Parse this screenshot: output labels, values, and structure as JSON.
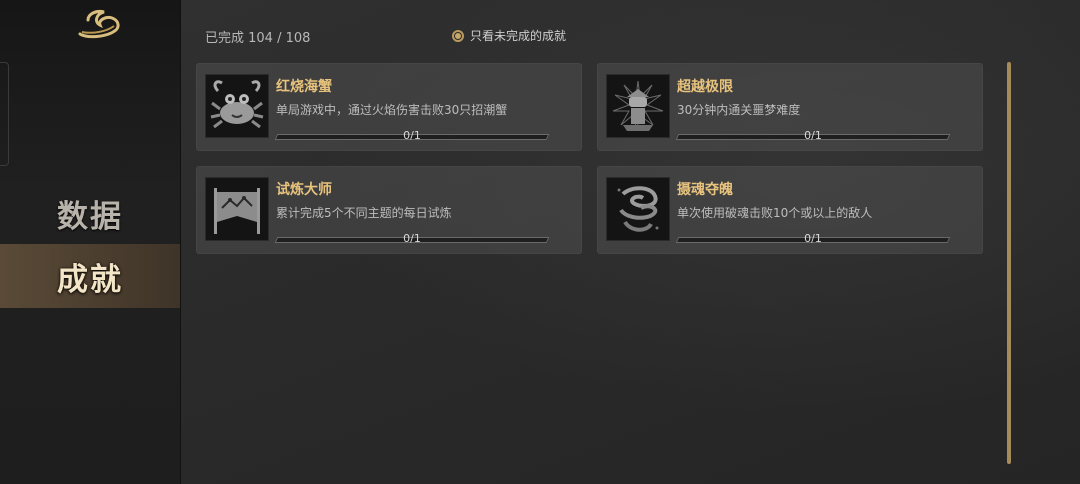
{
  "colors": {
    "accent_gold": "#e7c37d",
    "scrollbar": "#a58a5a",
    "selected_nav_bg": "#5a4a37"
  },
  "sidebar": {
    "logo_icon": "cloud-swirl-logo",
    "items": [
      {
        "label": "数据",
        "selected": false
      },
      {
        "label": "成就",
        "selected": true
      }
    ]
  },
  "header": {
    "completed_text": "已完成 104 / 108",
    "filter_label": "只看未完成的成就",
    "filter_checked": true
  },
  "achievements": [
    {
      "title": "红烧海蟹",
      "description": "单局游戏中，通过火焰伤害击败30只招潮蟹",
      "progress_text": "0/1",
      "progress": 0,
      "icon": "crab-icon"
    },
    {
      "title": "超越极限",
      "description": "30分钟内通关噩梦难度",
      "progress_text": "0/1",
      "progress": 0,
      "icon": "warrior-burst-icon"
    },
    {
      "title": "试炼大师",
      "description": "累计完成5个不同主题的每日试炼",
      "progress_text": "0/1",
      "progress": 0,
      "icon": "banner-flag-icon"
    },
    {
      "title": "摄魂夺魄",
      "description": "单次使用破魂击败10个或以上的敌人",
      "progress_text": "0/1",
      "progress": 0,
      "icon": "soul-vortex-icon"
    }
  ]
}
